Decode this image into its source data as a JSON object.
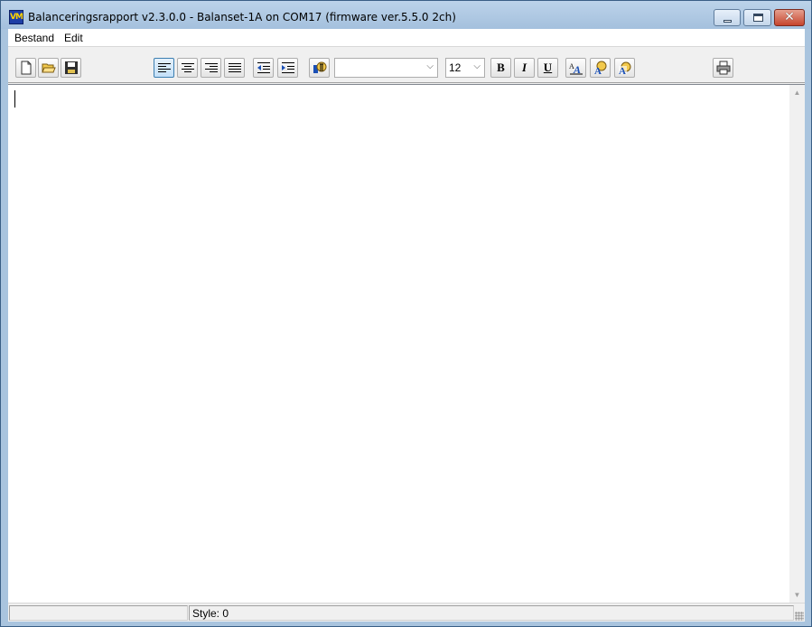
{
  "window": {
    "title": "Balanceringsrapport v2.3.0.0 - Balanset-1A on COM17 (firmware ver.5.5.0 2ch)",
    "icon_label": "VM",
    "close_glyph": "✕"
  },
  "menu": {
    "items": [
      {
        "label": "Bestand"
      },
      {
        "label": "Edit"
      }
    ]
  },
  "toolbar": {
    "font_name_value": "",
    "font_size_value": "12",
    "combo_arrow": "⌵",
    "bold_label": "B",
    "italic_label": "I",
    "underline_label": "U",
    "icons": [
      "new-document-icon",
      "open-folder-icon",
      "save-icon",
      "align-left-icon",
      "align-center-icon",
      "align-right-icon",
      "align-justify-icon",
      "decrease-indent-icon",
      "increase-indent-icon",
      "paragraph-icon",
      "font-icon",
      "text-color-icon",
      "background-color-icon",
      "print-icon"
    ]
  },
  "editor": {
    "scroll_up": "▲",
    "scroll_down": "▼"
  },
  "status": {
    "panel1": "",
    "panel2": "Style: 0"
  }
}
